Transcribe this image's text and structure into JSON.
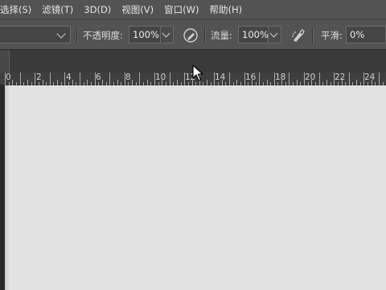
{
  "menubar": {
    "items": [
      "选择(S)",
      "滤镜(T)",
      "3D(D)",
      "视图(V)",
      "窗口(W)",
      "帮助(H)"
    ]
  },
  "options": {
    "opacity_label": "不透明度:",
    "opacity_value": "100%",
    "flow_label": "流量:",
    "flow_value": "100%",
    "smoothing_label": "平滑:",
    "smoothing_value": "0%"
  },
  "ruler": {
    "labels": [
      "0",
      "2",
      "4",
      "6",
      "8",
      "10",
      "12",
      "14",
      "16",
      "18",
      "20",
      "22",
      "24"
    ]
  },
  "icons": {
    "pressure_opacity": "pen-pressure-icon",
    "airbrush": "airbrush-icon",
    "cursor": "mouse-pointer-icon"
  }
}
